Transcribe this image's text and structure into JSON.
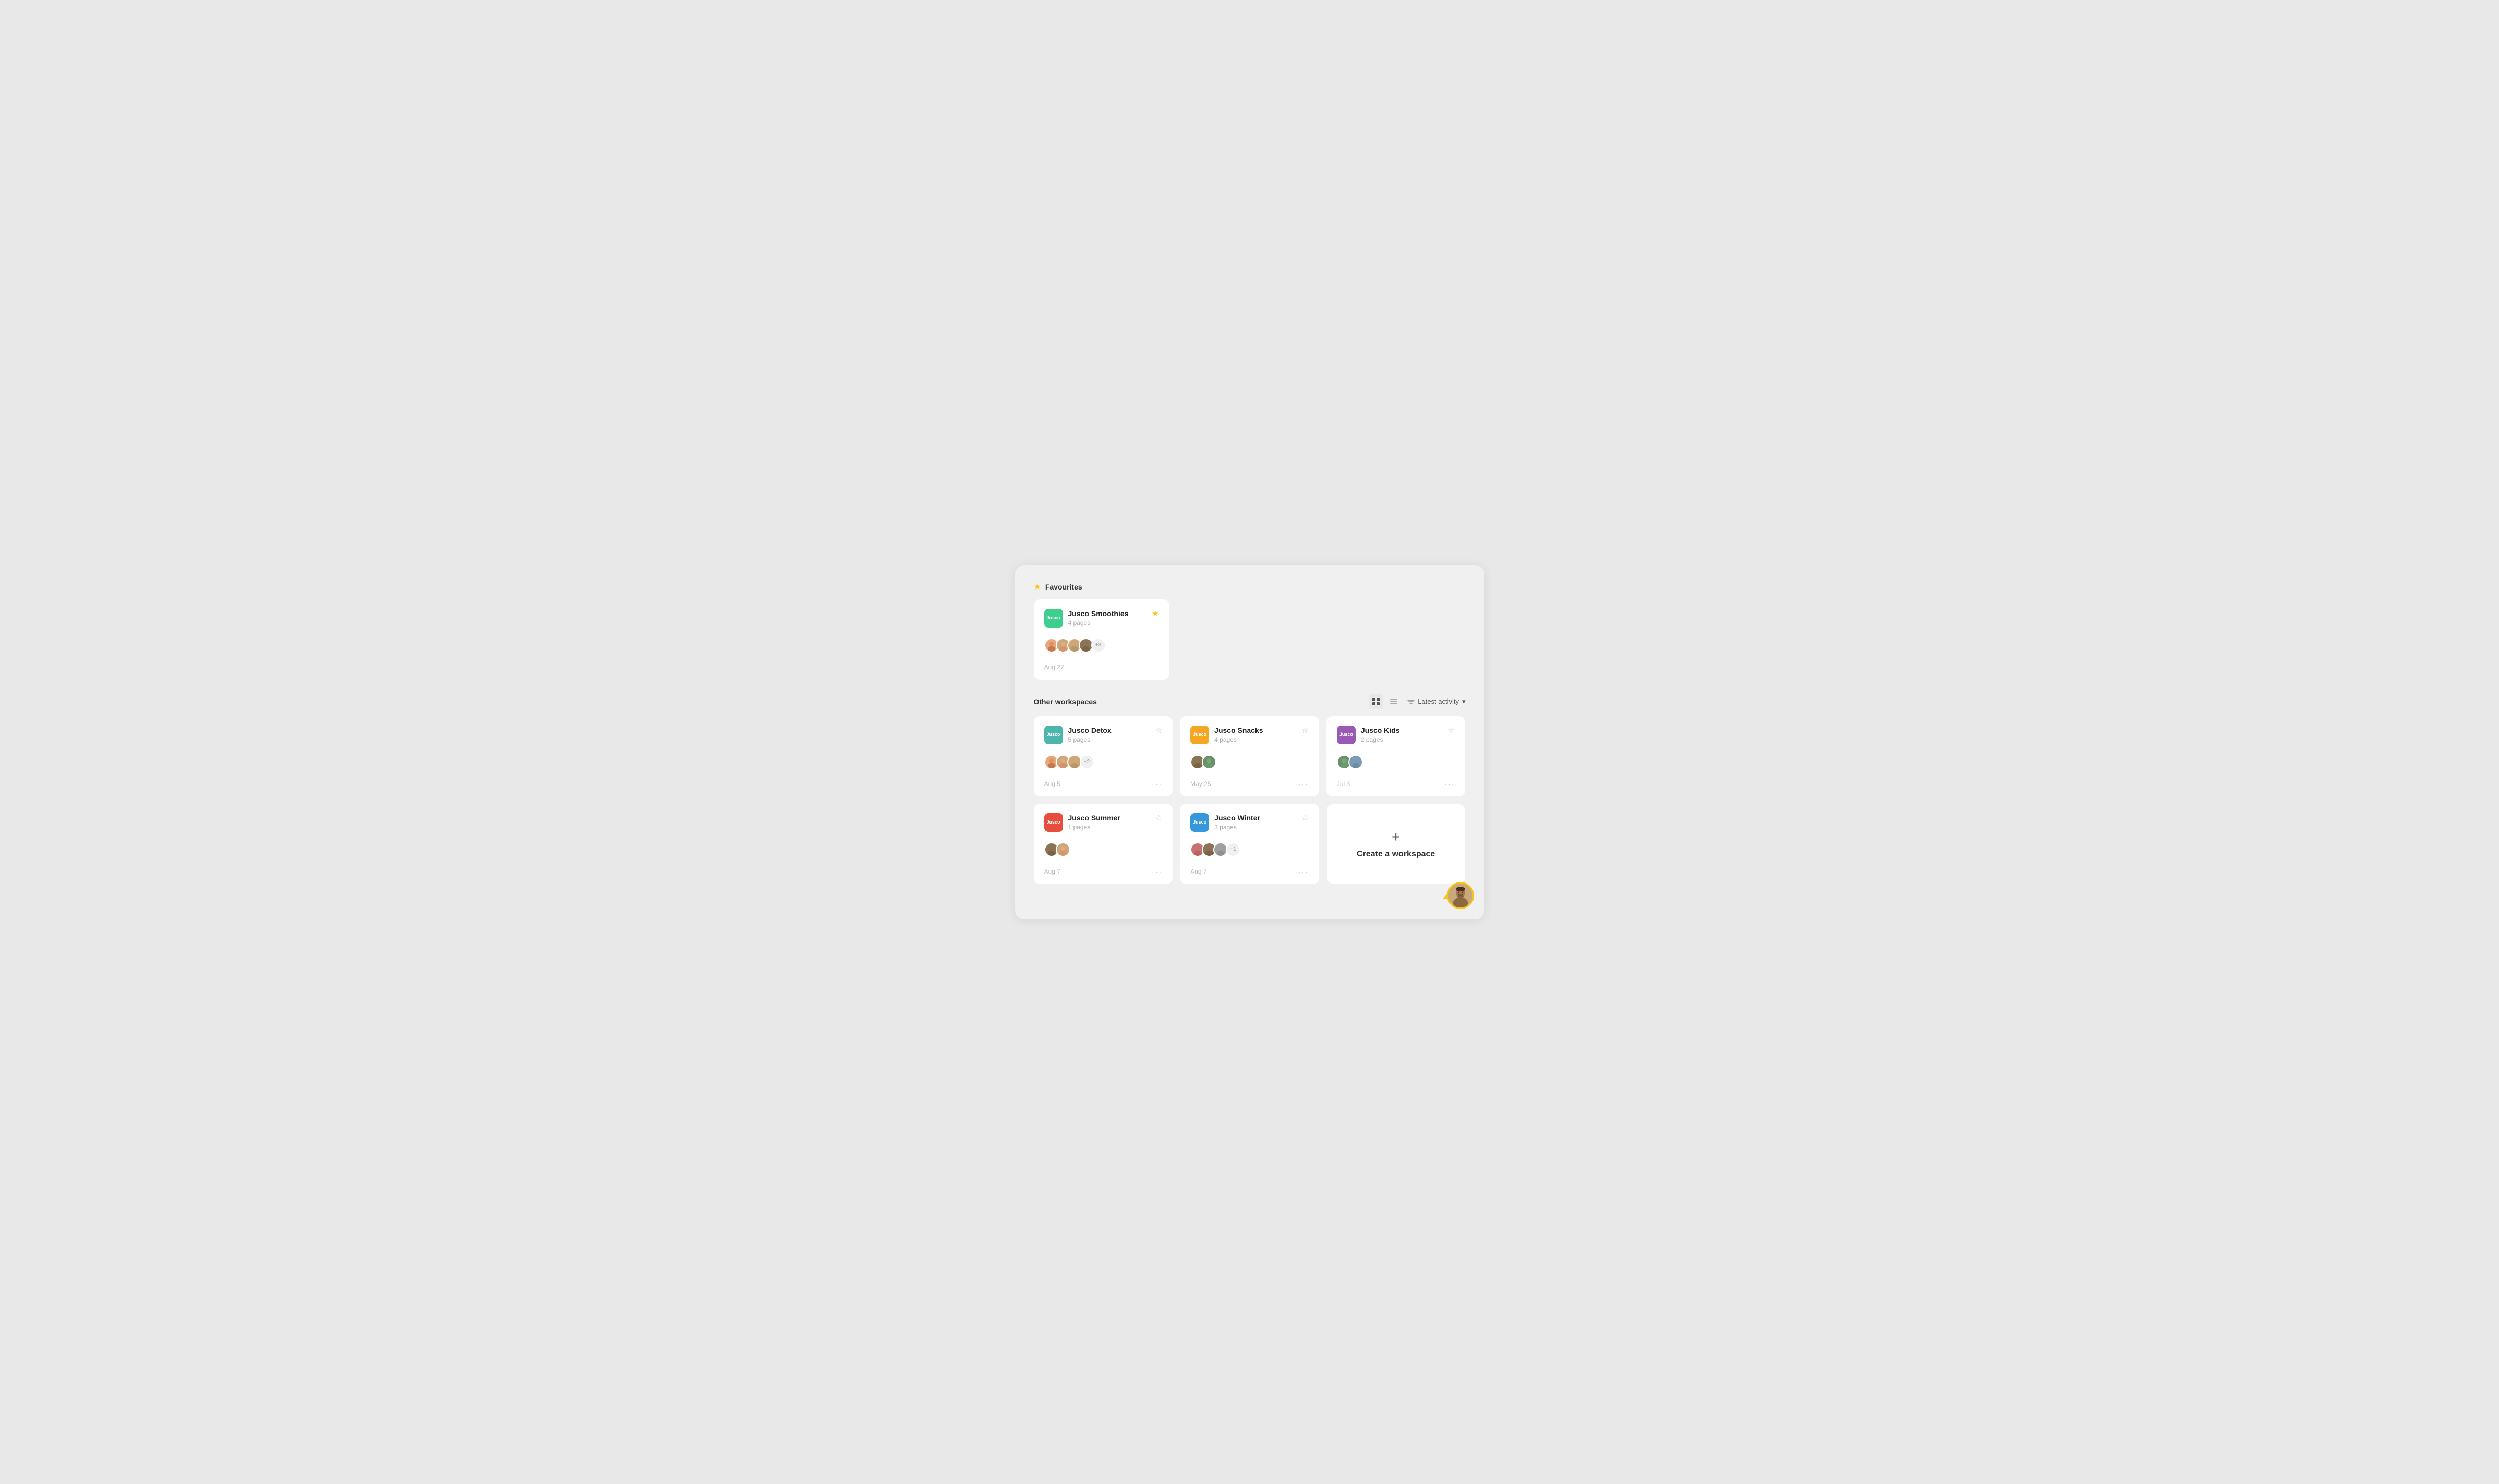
{
  "favourites": {
    "section_title": "Favourites",
    "workspaces": [
      {
        "id": "smoothies",
        "name": "Jusco Smoothies",
        "pages": "4 pages",
        "logo_color": "green",
        "logo_text": "Jusco",
        "star": true,
        "date": "Aug 27",
        "avatar_count": "+3",
        "avatars": [
          "a",
          "b",
          "c",
          "d"
        ]
      }
    ]
  },
  "other_workspaces": {
    "section_title": "Other workspaces",
    "sort_label": "Latest activity",
    "workspaces": [
      {
        "id": "detox",
        "name": "Jusco Detox",
        "pages": "5 pages",
        "logo_color": "teal",
        "logo_text": "Jusco",
        "star": false,
        "date": "Aug 5",
        "avatar_count": "+2",
        "avatars": [
          "a",
          "b",
          "c"
        ]
      },
      {
        "id": "snacks",
        "name": "Jusco Snacks",
        "pages": "4 pages",
        "logo_color": "orange",
        "logo_text": "Jusco",
        "star": false,
        "date": "May 25",
        "avatar_count": null,
        "avatars": [
          "d",
          "e"
        ]
      },
      {
        "id": "kids",
        "name": "Jusco Kids",
        "pages": "2 pages",
        "logo_color": "purple",
        "logo_text": "Jusco",
        "star": false,
        "date": "Jul 3",
        "avatar_count": null,
        "avatars": [
          "e",
          "f"
        ]
      },
      {
        "id": "summer",
        "name": "Jusco Summer",
        "pages": "1 pages",
        "logo_color": "red",
        "logo_text": "Jusco",
        "star": false,
        "date": "Aug 7",
        "avatar_count": null,
        "avatars": [
          "d",
          "b"
        ]
      },
      {
        "id": "winter",
        "name": "Jusco Winter",
        "pages": "3 pages",
        "logo_color": "blue",
        "logo_text": "Jusco",
        "star": false,
        "date": "Aug 7",
        "avatar_count": "+1",
        "avatars": [
          "g",
          "d",
          "h"
        ]
      }
    ]
  },
  "create_workspace": {
    "label": "Create a workspace",
    "plus_icon": "+"
  },
  "icons": {
    "star_filled": "★",
    "star_empty": "☆",
    "dots_menu": "···",
    "chevron_down": "▾"
  }
}
